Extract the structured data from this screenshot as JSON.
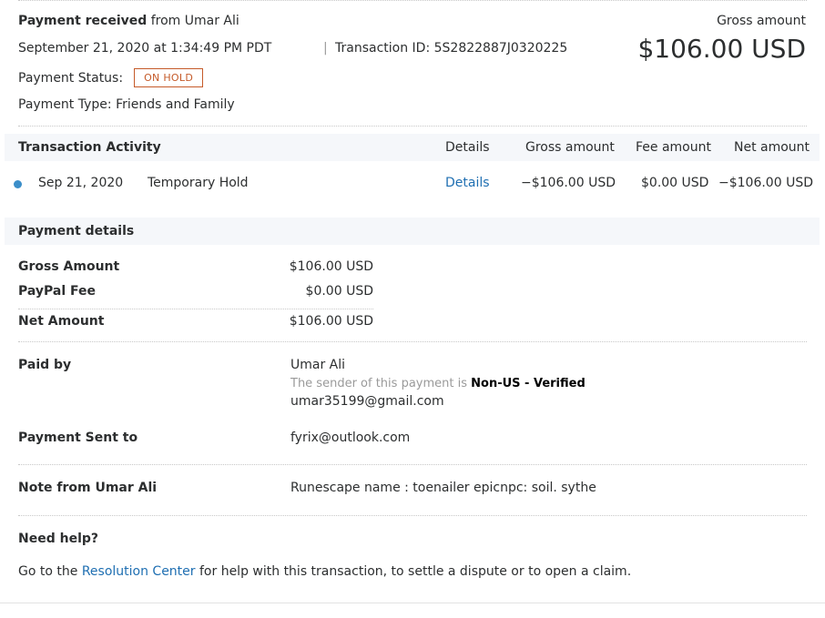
{
  "header": {
    "received_bold": "Payment received",
    "received_from": "from Umar Ali",
    "date": "September 21, 2020 at 1:34:49 PM PDT",
    "separator": "|",
    "transaction_id": "Transaction ID: 5S2822887J0320225",
    "status_label": "Payment Status:",
    "status_badge": "ON HOLD",
    "payment_type": "Payment Type: Friends and Family",
    "gross_label": "Gross amount",
    "gross_value": "$106.00 USD"
  },
  "activity": {
    "title": "Transaction Activity",
    "columns": {
      "details": "Details",
      "gross": "Gross amount",
      "fee": "Fee amount",
      "net": "Net amount"
    },
    "rows": [
      {
        "date": "Sep 21, 2020",
        "description": "Temporary Hold",
        "details_link": "Details",
        "gross": "−$106.00 USD",
        "fee": "$0.00 USD",
        "net": "−$106.00 USD"
      }
    ]
  },
  "payment_details": {
    "title": "Payment details",
    "amounts": [
      {
        "label": "Gross Amount",
        "value": "$106.00 USD"
      },
      {
        "label": "PayPal Fee",
        "value": "$0.00 USD"
      },
      {
        "label": "Net Amount",
        "value": "$106.00 USD"
      }
    ],
    "paid_by": {
      "label": "Paid by",
      "name": "Umar Ali",
      "sender_note_prefix": "The sender of this payment is",
      "sender_note_bold": "Non-US - Verified",
      "email": "umar35199@gmail.com"
    },
    "sent_to": {
      "label": "Payment Sent to",
      "value": "fyrix@outlook.com"
    },
    "note": {
      "label": "Note from Umar Ali",
      "value": "Runescape name : toenailer epicnpc: soil. sythe"
    }
  },
  "help": {
    "title": "Need help?",
    "text_before": "Go to the",
    "link": "Resolution Center",
    "text_after": "for help with this transaction, to settle a dispute or to open a claim."
  },
  "colors": {
    "badge": "#c55a29",
    "link": "#1f6fb2",
    "dot": "#3b8ec9",
    "section_bg": "#f5f7fa"
  }
}
